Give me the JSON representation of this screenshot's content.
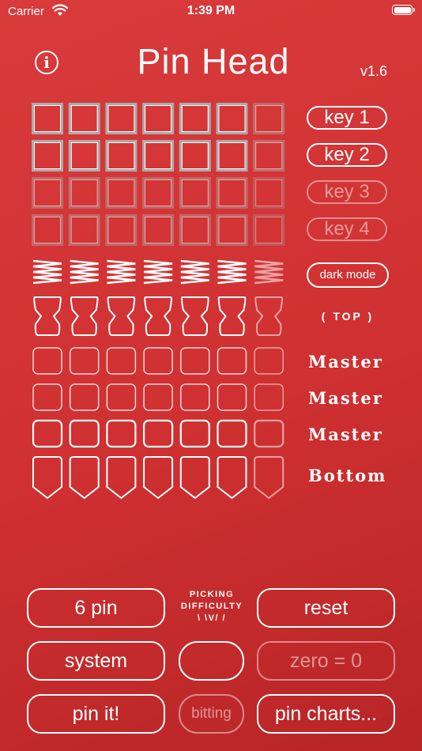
{
  "status_bar": {
    "carrier": "Carrier",
    "time": "1:39 PM"
  },
  "header": {
    "title": "Pin Head",
    "version": "v1.6",
    "info_icon": "i"
  },
  "keys": [
    {
      "label": "key 1",
      "active": true
    },
    {
      "label": "key 2",
      "active": true
    },
    {
      "label": "key 3",
      "active": false
    },
    {
      "label": "key 4",
      "active": false
    }
  ],
  "dark_mode_label": "dark mode",
  "top_label": "( TOP )",
  "master_labels": [
    "Master",
    "Master",
    "Master"
  ],
  "bottom_label": "Bottom",
  "controls": {
    "pin_count": "6 pin",
    "reset": "reset",
    "system": "system",
    "blank": "",
    "zero": "zero = 0",
    "pin_it": "pin it!",
    "bitting": "bitting",
    "pin_charts": "pin charts..."
  },
  "picking_difficulty": {
    "line1": "PICKING",
    "line2": "DIFFICULTY",
    "line3": "\\ \\V/ /"
  },
  "pin_columns": 7,
  "active_columns": 6,
  "colors": {
    "background": "#d33536",
    "foreground": "#ffffff"
  }
}
